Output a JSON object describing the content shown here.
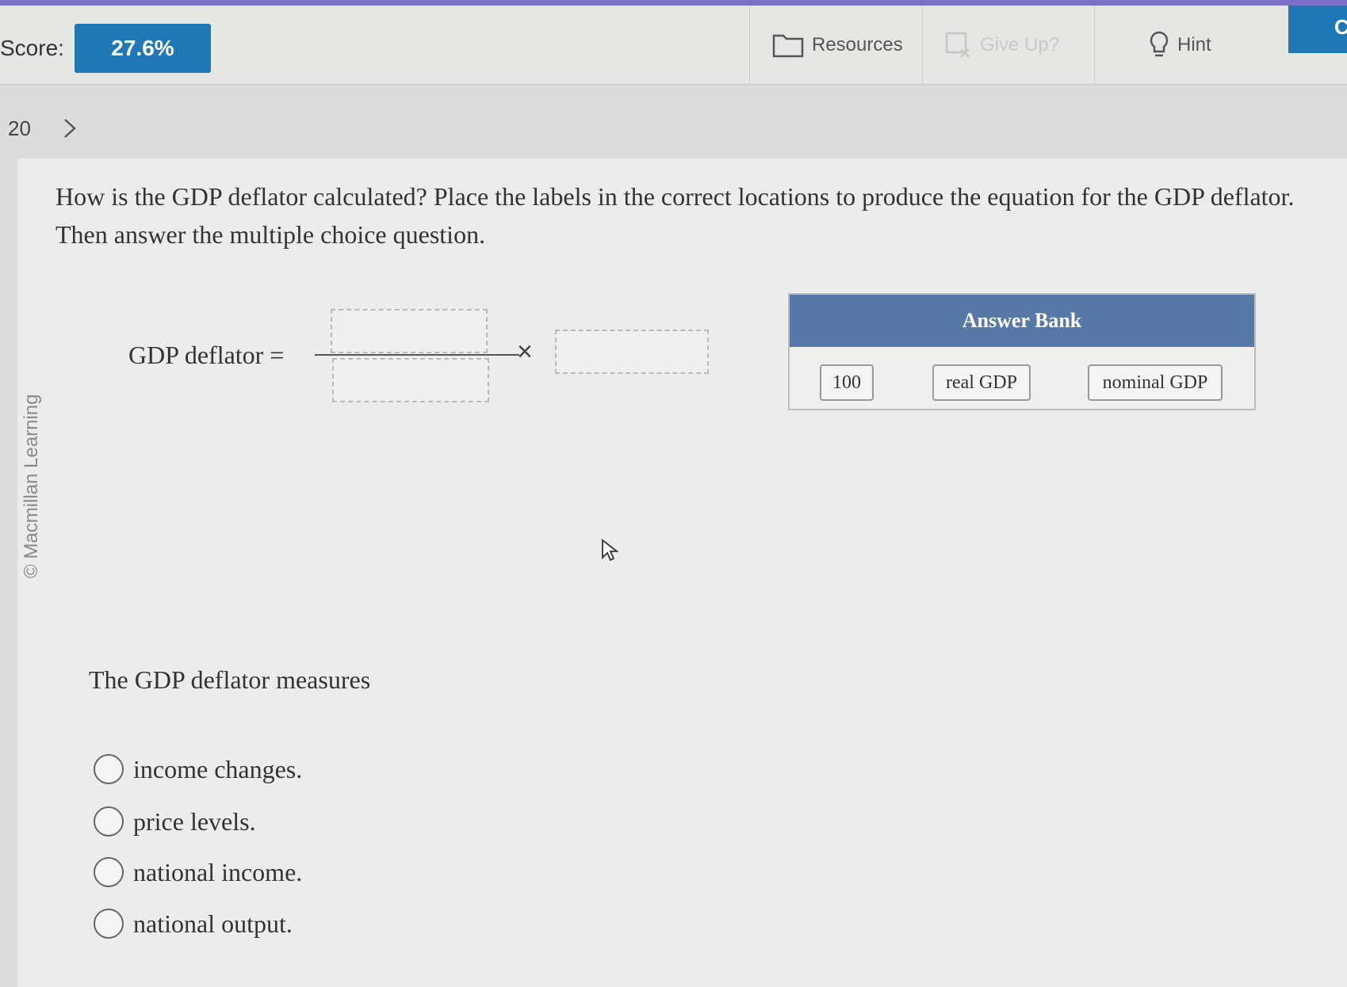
{
  "header": {
    "score_label": "Score:",
    "score_value": "27.6%",
    "resources_label": "Resources",
    "giveup_label": "Give Up?",
    "hint_label": "Hint",
    "check_label": "C"
  },
  "nav": {
    "question_number": "20"
  },
  "watermark": "© Macmillan Learning",
  "prompt": "How is the GDP deflator calculated? Place the labels in the correct locations to produce the equation for the GDP deflator. Then answer the multiple choice question.",
  "equation": {
    "label": "GDP deflator =",
    "times": "×"
  },
  "answer_bank": {
    "title": "Answer Bank",
    "items": [
      "100",
      "real GDP",
      "nominal GDP"
    ]
  },
  "mc": {
    "question": "The GDP deflator measures",
    "options": [
      "income changes.",
      "price levels.",
      "national income.",
      "national output."
    ]
  }
}
